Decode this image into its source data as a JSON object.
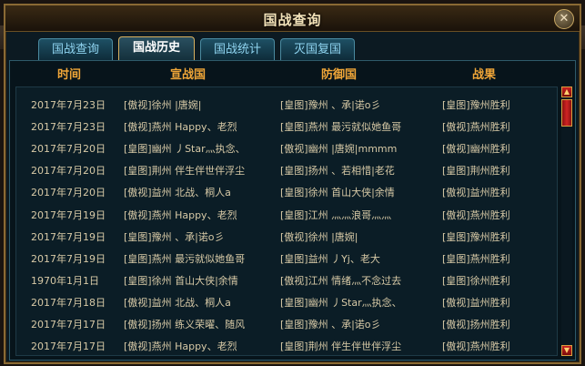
{
  "window": {
    "title": "国战查询",
    "close_label": "✕"
  },
  "tabs": [
    {
      "label": "国战查询"
    },
    {
      "label": "国战历史"
    },
    {
      "label": "国战统计"
    },
    {
      "label": "灭国复国"
    }
  ],
  "active_tab": "国战历史",
  "columns": {
    "time": "时间",
    "attacker": "宣战国",
    "defender": "防御国",
    "result": "战果"
  },
  "rows": [
    {
      "time": "2017年7月23日",
      "attacker": "[傲视]徐州 |唐婉|",
      "defender": "[皇图]豫州 、承|诺o彡",
      "result": "[皇图]豫州胜利"
    },
    {
      "time": "2017年7月23日",
      "attacker": "[傲视]燕州 Happy、老烈",
      "defender": "[皇图]燕州 最污就似她鱼哥",
      "result": "[傲视]燕州胜利"
    },
    {
      "time": "2017年7月20日",
      "attacker": "[皇图]幽州 丿Star灬执念、",
      "defender": "[傲视]幽州 |唐婉|mmmm",
      "result": "[傲视]幽州胜利"
    },
    {
      "time": "2017年7月20日",
      "attacker": "[皇图]荆州 伴生伴世伴浮尘",
      "defender": "[皇图]扬州 、若相惜|老花",
      "result": "[皇图]荆州胜利"
    },
    {
      "time": "2017年7月20日",
      "attacker": "[傲视]益州 北战、桐人a",
      "defender": "[皇图]徐州 首山大侠|余情",
      "result": "[傲视]益州胜利"
    },
    {
      "time": "2017年7月19日",
      "attacker": "[傲视]燕州 Happy、老烈",
      "defender": "[皇图]江州 灬灬浪哥灬灬",
      "result": "[傲视]燕州胜利"
    },
    {
      "time": "2017年7月19日",
      "attacker": "[皇图]豫州 、承|诺o彡",
      "defender": "[傲视]徐州 |唐婉|",
      "result": "[皇图]豫州胜利"
    },
    {
      "time": "2017年7月19日",
      "attacker": "[皇图]燕州 最污就似她鱼哥",
      "defender": "[皇图]益州 丿Yj、老大",
      "result": "[皇图]燕州胜利"
    },
    {
      "time": "1970年1月1日",
      "attacker": "[皇图]徐州 首山大侠|余情",
      "defender": "[傲视]江州 情绪灬不念过去",
      "result": "[皇图]徐州胜利"
    },
    {
      "time": "2017年7月18日",
      "attacker": "[傲视]益州 北战、桐人a",
      "defender": "[皇图]幽州 丿Star灬执念、",
      "result": "[傲视]益州胜利"
    },
    {
      "time": "2017年7月17日",
      "attacker": "[傲视]扬州 练义荣曜、随风",
      "defender": "[皇图]豫州 、承|诺o彡",
      "result": "[傲视]扬州胜利"
    },
    {
      "time": "2017年7月17日",
      "attacker": "[傲视]燕州 Happy、老烈",
      "defender": "[皇图]荆州 伴生伴世伴浮尘",
      "result": "[傲视]燕州胜利"
    }
  ],
  "colors": {
    "header": "#f0a638",
    "row_text": "#d7c9a6",
    "tab_text": "#8fd4f0",
    "frame": "#8a6a34"
  }
}
